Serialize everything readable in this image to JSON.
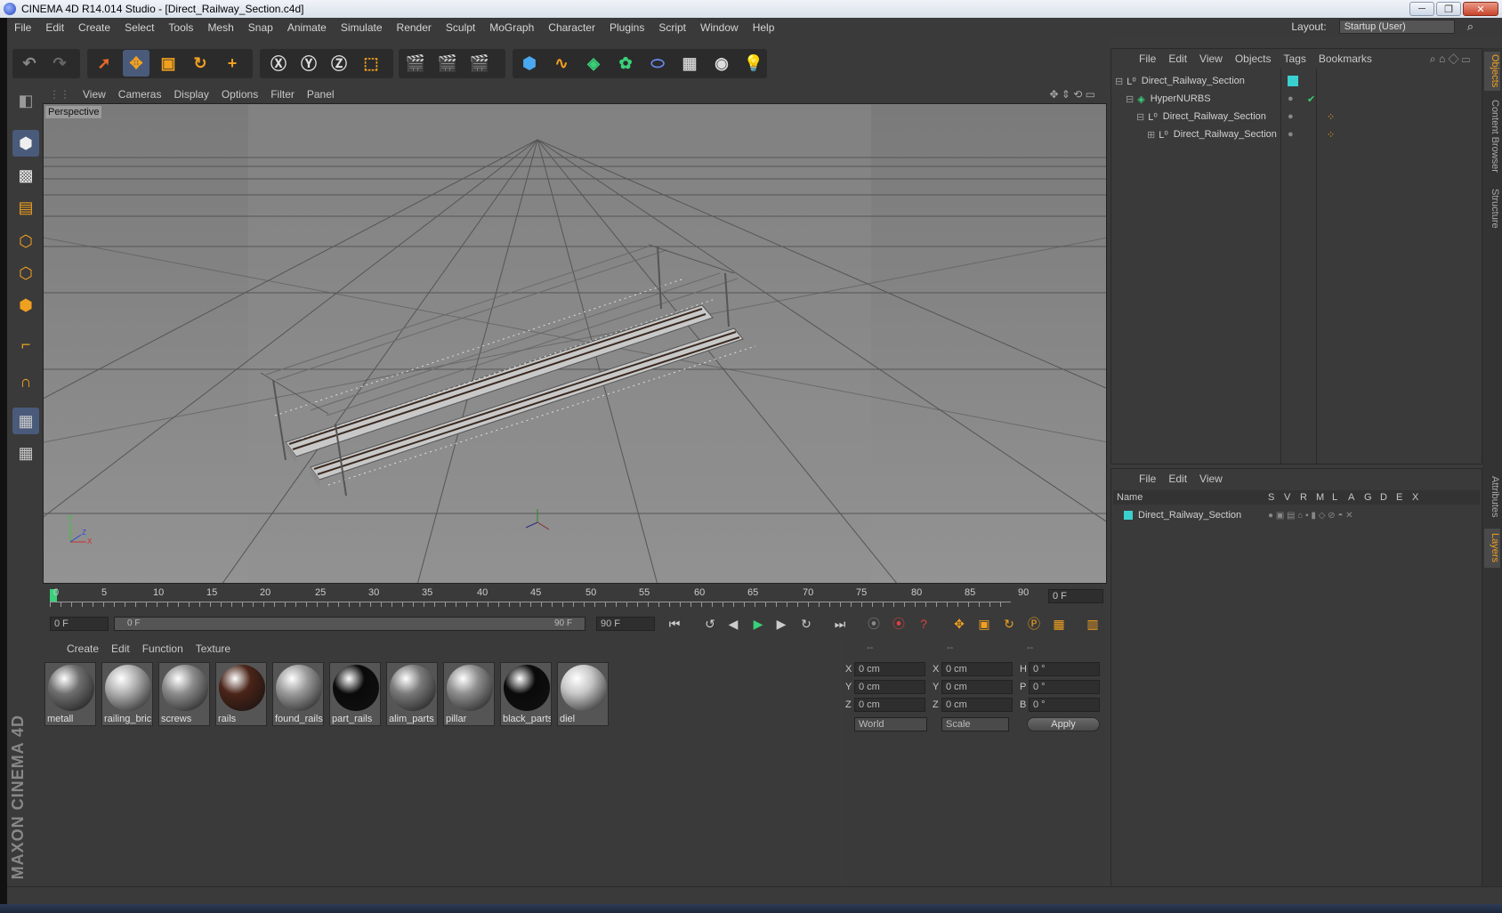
{
  "window": {
    "title": "CINEMA 4D R14.014 Studio - [Direct_Railway_Section.c4d]",
    "minimize": "─",
    "restore": "❐",
    "close": "✕"
  },
  "menu": [
    "File",
    "Edit",
    "Create",
    "Select",
    "Tools",
    "Mesh",
    "Snap",
    "Animate",
    "Simulate",
    "Render",
    "Sculpt",
    "MoGraph",
    "Character",
    "Plugins",
    "Script",
    "Window",
    "Help"
  ],
  "layout": {
    "label": "Layout:",
    "value": "Startup (User)"
  },
  "viewport": {
    "menu": [
      "View",
      "Cameras",
      "Display",
      "Options",
      "Filter",
      "Panel"
    ],
    "label": "Perspective"
  },
  "timeline": {
    "ticks": [
      "0",
      "5",
      "10",
      "15",
      "20",
      "25",
      "30",
      "35",
      "40",
      "45",
      "50",
      "55",
      "60",
      "65",
      "70",
      "75",
      "80",
      "85",
      "90"
    ],
    "current_frame": "0 F"
  },
  "transport": {
    "start": "0 F",
    "range_start": "0 F",
    "range_end": "90 F",
    "end": "90 F"
  },
  "materials": {
    "menu": [
      "Create",
      "Edit",
      "Function",
      "Texture"
    ],
    "items": [
      {
        "name": "metall",
        "color": "#6f6f6f"
      },
      {
        "name": "railing_bric",
        "color": "#b0b0b0"
      },
      {
        "name": "screws",
        "color": "#8c8c8c"
      },
      {
        "name": "rails",
        "color": "#4a2418"
      },
      {
        "name": "found_rails",
        "color": "#9a9a9a"
      },
      {
        "name": "part_rails",
        "color": "#0a0a0a"
      },
      {
        "name": "alim_parts",
        "color": "#7a7a7a"
      },
      {
        "name": "pillar",
        "color": "#8e8e8e"
      },
      {
        "name": "black_parts",
        "color": "#0a0a0a"
      },
      {
        "name": "diel",
        "color": "#c6c6c6"
      }
    ]
  },
  "coords": {
    "headers": [
      "--",
      "--",
      "--"
    ],
    "rows": [
      {
        "a": "X",
        "av": "0 cm",
        "b": "X",
        "bv": "0 cm",
        "c": "H",
        "cv": "0 °"
      },
      {
        "a": "Y",
        "av": "0 cm",
        "b": "Y",
        "bv": "0 cm",
        "c": "P",
        "cv": "0 °"
      },
      {
        "a": "Z",
        "av": "0 cm",
        "b": "Z",
        "bv": "0 cm",
        "c": "B",
        "cv": "0 °"
      }
    ],
    "world": "World",
    "scale": "Scale",
    "apply": "Apply"
  },
  "objects": {
    "menu": [
      "File",
      "Edit",
      "View",
      "Objects",
      "Tags",
      "Bookmarks"
    ],
    "tree": [
      "Direct_Railway_Section",
      "HyperNURBS",
      "Direct_Railway_Section",
      "Direct_Railway_Section"
    ]
  },
  "layers": {
    "menu": [
      "File",
      "Edit",
      "View"
    ],
    "columns": [
      "Name",
      "S",
      "V",
      "R",
      "M",
      "L",
      "A",
      "G",
      "D",
      "E",
      "X"
    ],
    "row": "Direct_Railway_Section"
  },
  "right_tabs": [
    "Objects",
    "Content Browser",
    "Structure",
    "Attributes",
    "Layers"
  ],
  "brand": "MAXON CINEMA 4D"
}
